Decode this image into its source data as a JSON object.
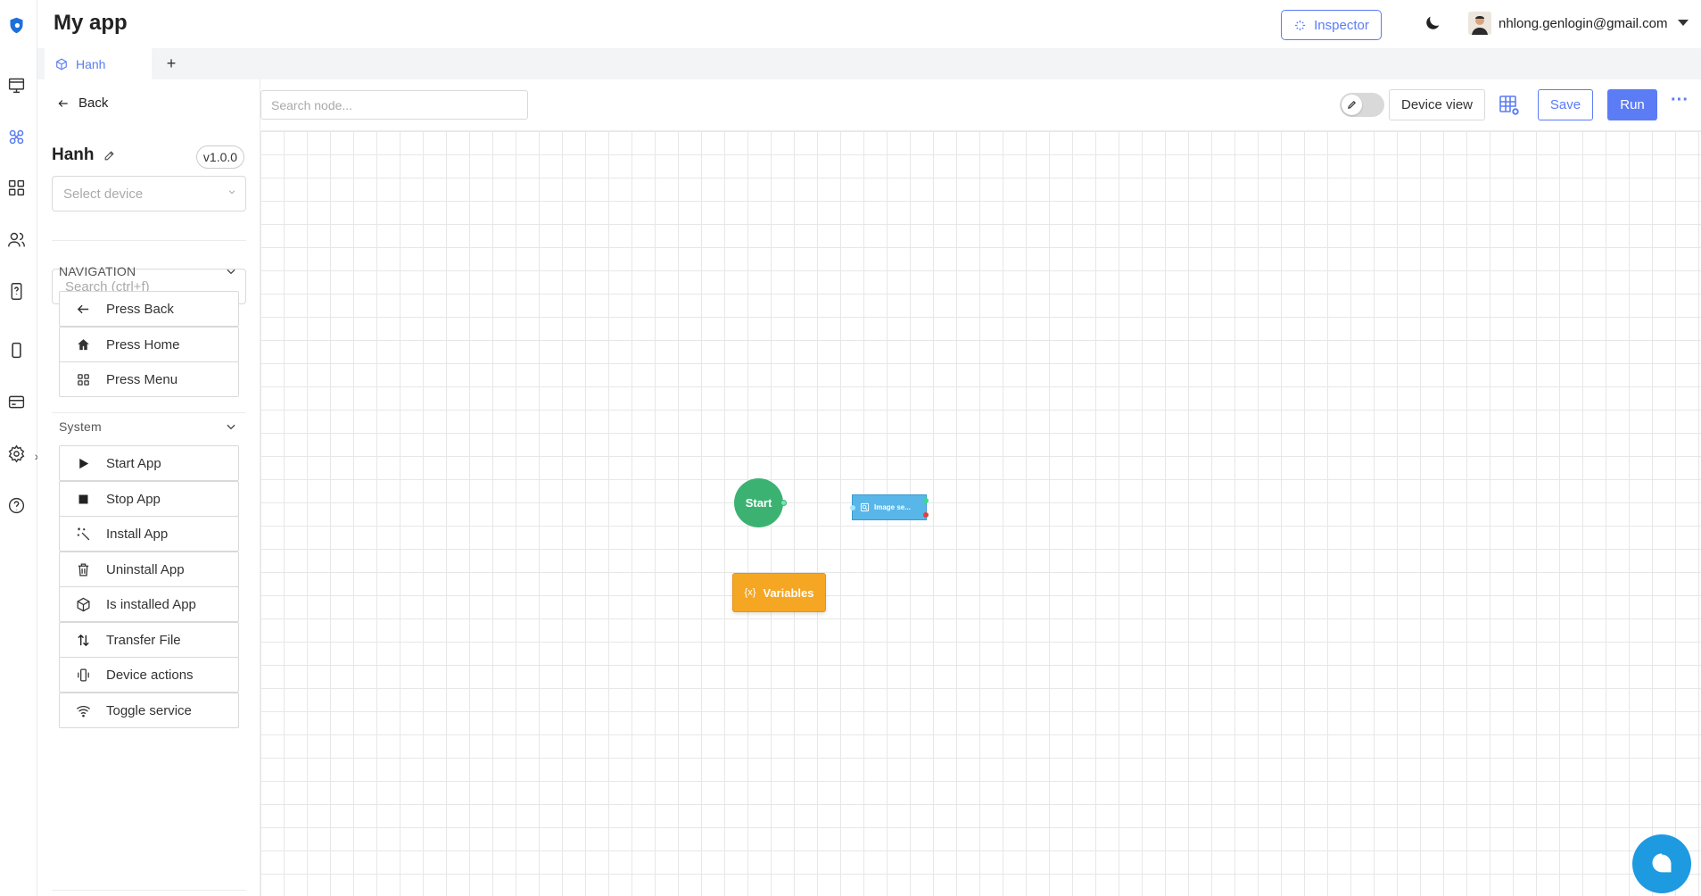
{
  "header": {
    "app_title": "My app",
    "inspector_label": "Inspector",
    "user_email": "nhlong.genlogin@gmail.com",
    "accent_color": "#5b7cf5"
  },
  "tabs": [
    {
      "label": "Hanh",
      "active": true
    }
  ],
  "tab_add_label": "+",
  "rail": {
    "icons": [
      "logo-icon",
      "dashboard-icon",
      "automation-icon",
      "apps-grid-icon",
      "users-icon",
      "phone-help-icon",
      "mobile-icon",
      "card-icon",
      "settings-icon",
      "help-icon"
    ],
    "active": "automation-icon"
  },
  "panel": {
    "back_label": "Back",
    "project_name": "Hanh",
    "version": "v1.0.0",
    "device_placeholder": "Select device",
    "search_placeholder": "Search (ctrl+f)",
    "sections": [
      {
        "title": "NAVIGATION",
        "items": [
          {
            "label": "Press Back",
            "icon": "arrow-left-icon"
          },
          {
            "label": "Press Home",
            "icon": "home-icon"
          },
          {
            "label": "Press Menu",
            "icon": "grid-icon"
          }
        ]
      },
      {
        "title": "System",
        "items": [
          {
            "label": "Start App",
            "icon": "play-icon"
          },
          {
            "label": "Stop App",
            "icon": "stop-icon"
          },
          {
            "label": "Install App",
            "icon": "magic-wand-icon"
          },
          {
            "label": "Uninstall App",
            "icon": "trash-icon"
          },
          {
            "label": "Is installed App",
            "icon": "cube-icon"
          },
          {
            "label": "Transfer File",
            "icon": "transfer-icon"
          },
          {
            "label": "Device actions",
            "icon": "vibrate-icon"
          },
          {
            "label": "Toggle service",
            "icon": "wifi-icon"
          }
        ]
      }
    ]
  },
  "toolbar": {
    "search_placeholder": "Search node...",
    "device_view_label": "Device view",
    "save_label": "Save",
    "run_label": "Run",
    "more_label": "···"
  },
  "canvas": {
    "nodes": {
      "start": "Start",
      "image": "Image se...",
      "variables": "Variables",
      "variables_icon": "{x}"
    }
  }
}
